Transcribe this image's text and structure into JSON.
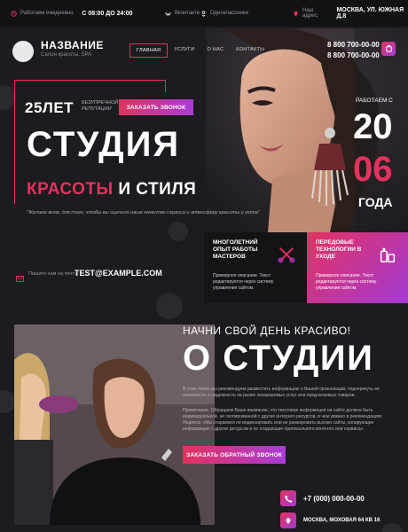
{
  "topbar": {
    "hours_label": "Работаем ежедневно",
    "hours_value": "С 08:00 ДО 24:00",
    "link1": "Вконтакте",
    "link2": "Одноклассники",
    "address_label": "Наш адрес:",
    "address_value": "МОСКВА, УЛ. ЮЖНАЯ Д.8"
  },
  "header": {
    "brand": "НАЗВАНИЕ",
    "brand_sub": "Салон красоты, SPA",
    "nav": [
      "ГЛАВНАЯ",
      "УСЛУГИ",
      "О НАС",
      "КОНТАКТЫ"
    ],
    "phone1": "8 800 700-00-00",
    "phone2": "8 800 700-00-00"
  },
  "hero": {
    "years": "25ЛЕТ",
    "reputation": "БЕЗУПРЕЧНОЙ РЕПУТАЦИИ",
    "call_button": "ЗАКАЗАТЬ ЗВОНОК",
    "title_line1": "СТУДИЯ",
    "title_line2_accent": "КРАСОТЫ",
    "title_line2_rest": " И СТИЛЯ",
    "quote": "\"Желаем всем, для того, чтобы вы оценили наше качество сервиса и атмосферу красоты и уюта\"",
    "working_since": "РАБОТАЕМ С",
    "year_part1": "20",
    "year_part2": "06",
    "year_word": "ГОДА"
  },
  "features": [
    {
      "title": "МНОГОЛЕТНИЙ ОПЫТ РАБОТЫ МАСТЕРОВ",
      "text": "Примерное описание. Текст редактируется через систему управления сайтом."
    },
    {
      "title": "ПЕРЕДОВЫЕ ТЕХНОЛОГИИ В УХОДЕ",
      "text": "Примерное описание. Текст редактируется через систему управления сайтом."
    }
  ],
  "email": {
    "label": "Пишите нам на почту:",
    "value": "TEST@EXAMPLE.COM"
  },
  "about": {
    "subtitle": "НАЧНИ СВОЙ ДЕНЬ КРАСИВО!",
    "title": "О СТУДИИ",
    "p1": "В этом блоке мы рекомендуем разместить информацию о Вашей организации, подчеркнуть ее значимость и надежность на рынке оказываемых услуг или предлагаемых товаров.",
    "p2": "Примечание. Обращаем Ваше внимание, что текстовая информация на сайте должна быть индивидуальной, не скопированной с других интернет-ресурсов, в чем уважно в рекомендациях Яндекса: «Мы стараемся не индексировать или не ранжировать высоко сайты, копирующие информацию с других ресурсов и не создающие оригинального контента или сервиса».",
    "order_button": "ЗАКАЗАТЬ ОБРАТНЫЙ ЗВОНОК",
    "phone": "+7 (000) 000-00-00",
    "address": "МОСКВА, МОХОВАЯ 64 КВ 16"
  },
  "colors": {
    "accent": "#e3325f",
    "gradient_end": "#a33ad4",
    "background": "#1c1b1f"
  }
}
